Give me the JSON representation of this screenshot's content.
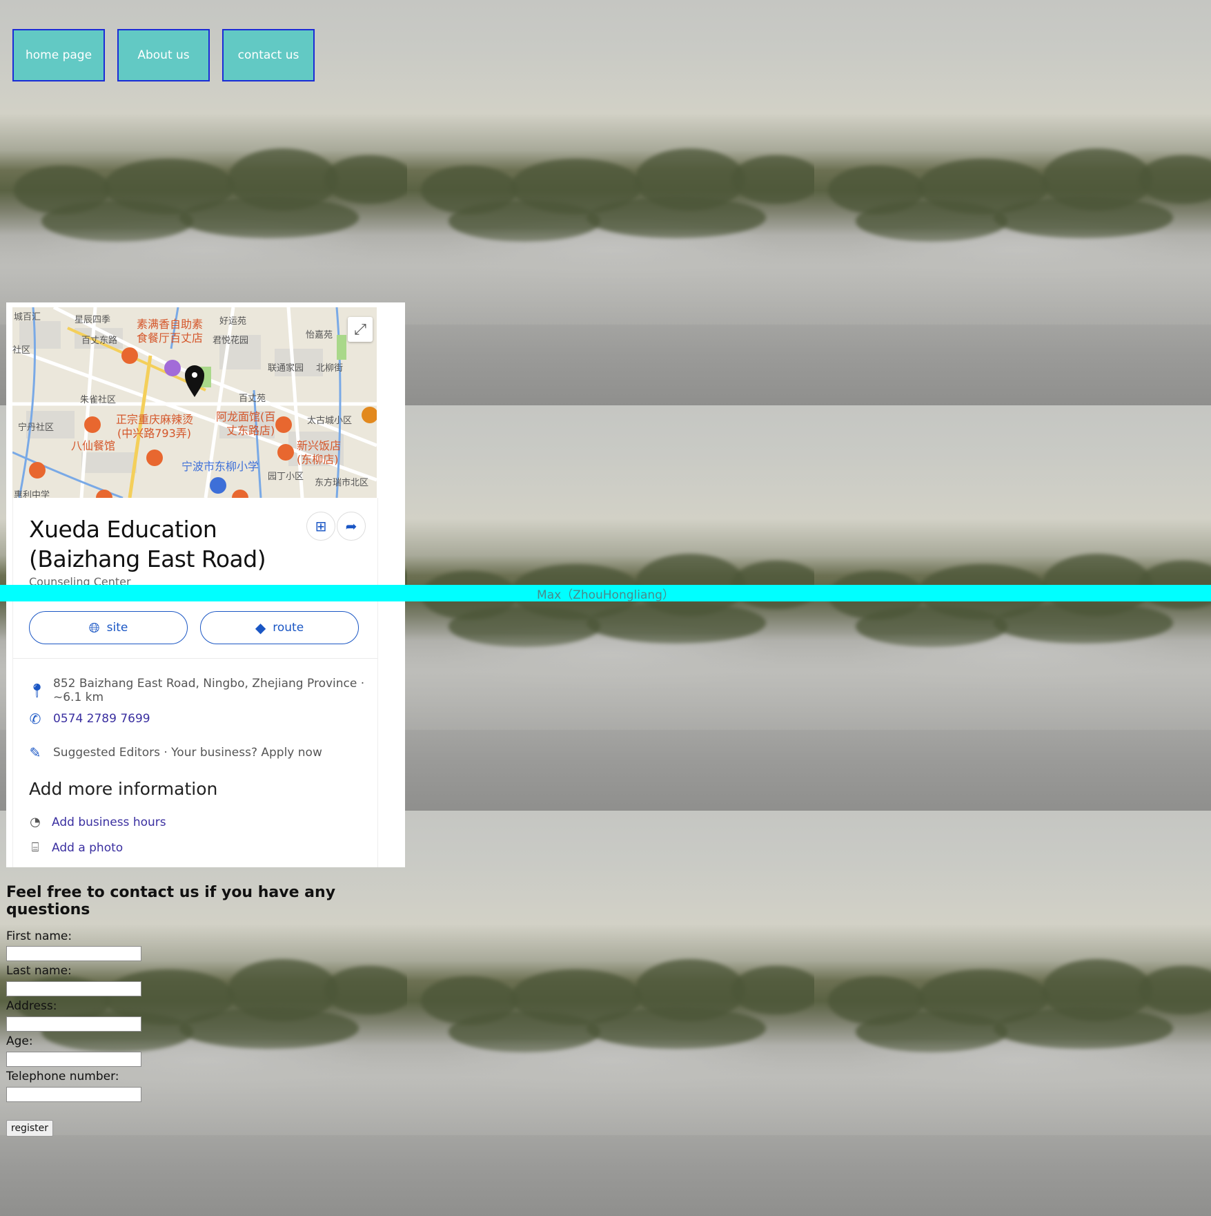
{
  "nav": {
    "items": [
      "home page",
      "About us",
      "contact us"
    ]
  },
  "map_card": {
    "title": "Xueda Education (Baizhang East Road)",
    "category": "Counseling Center",
    "buttons": {
      "site": "site",
      "route": "route"
    },
    "address": "852 Baizhang East Road, Ningbo, Zhejiang Province · ~6.1 km",
    "phone": "0574 2789 7699",
    "suggest": "Suggested Editors · Your business? Apply now",
    "more_title": "Add more information",
    "more_links": [
      "Add business hours",
      "Add a photo"
    ],
    "map_labels": [
      "城百汇",
      "星辰四季",
      "素满香自助素",
      "食餐厅百丈店",
      "好运苑",
      "怡嘉苑",
      "社区",
      "百丈东路",
      "君悦花园",
      "联通家园",
      "北柳街",
      "朱雀社区",
      "百丈苑",
      "正宗重庆麻辣烫",
      "(中兴路793弄)",
      "阿龙面馆(百",
      "丈东路店)",
      "太古城小区",
      "宁丹社区",
      "八仙餐馆",
      "新兴饭店",
      "(东柳店)",
      "宁波市东柳小学",
      "园丁小区",
      "东方瑞市北区",
      "惠利中学"
    ]
  },
  "banner": {
    "text": "Max（ZhouHongliang）"
  },
  "form": {
    "heading": "Feel free to contact us if you have any questions",
    "fields": [
      "First name:",
      "Last name:",
      "Address:",
      "Age:",
      "Telephone number:"
    ],
    "submit": "register"
  },
  "colors": {
    "nav_bg": "#62c9c4",
    "nav_border": "#1a2bd6",
    "banner": "#00ffff",
    "link": "#3a2fa0",
    "accent": "#1a56c4"
  },
  "icons": {
    "expand": "expand-icon",
    "save": "save-icon",
    "share": "share-icon",
    "site": "globe-icon",
    "route": "directions-icon",
    "address": "map-pin-icon",
    "phone": "phone-icon",
    "edit": "pencil-icon",
    "hours": "clock-icon",
    "photo": "camera-icon"
  }
}
